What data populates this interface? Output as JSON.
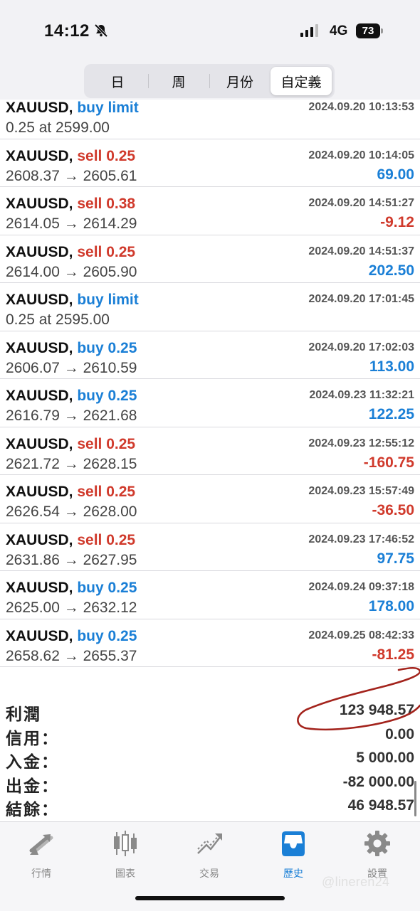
{
  "status_bar": {
    "time": "14:12",
    "network": "4G",
    "battery": "73"
  },
  "segmented": {
    "options": [
      "日",
      "周",
      "月份",
      "自定義"
    ],
    "active_index": 3
  },
  "trades": [
    {
      "symbol": "XAUUSD,",
      "side": "buy",
      "side_label": "buy limit",
      "time": "2024.09.20 10:13:53",
      "price": "0.25 at 2599.00",
      "profit": ""
    },
    {
      "symbol": "XAUUSD,",
      "side": "sell",
      "side_label": "sell 0.25",
      "time": "2024.09.20 10:14:05",
      "price": "2608.37 → 2605.61",
      "profit": "69.00"
    },
    {
      "symbol": "XAUUSD,",
      "side": "sell",
      "side_label": "sell 0.38",
      "time": "2024.09.20 14:51:27",
      "price": "2614.05 → 2614.29",
      "profit": "-9.12"
    },
    {
      "symbol": "XAUUSD,",
      "side": "sell",
      "side_label": "sell 0.25",
      "time": "2024.09.20 14:51:37",
      "price": "2614.00 → 2605.90",
      "profit": "202.50"
    },
    {
      "symbol": "XAUUSD,",
      "side": "buy",
      "side_label": "buy limit",
      "time": "2024.09.20 17:01:45",
      "price": "0.25 at 2595.00",
      "profit": ""
    },
    {
      "symbol": "XAUUSD,",
      "side": "buy",
      "side_label": "buy 0.25",
      "time": "2024.09.20 17:02:03",
      "price": "2606.07 → 2610.59",
      "profit": "113.00"
    },
    {
      "symbol": "XAUUSD,",
      "side": "buy",
      "side_label": "buy 0.25",
      "time": "2024.09.23 11:32:21",
      "price": "2616.79 → 2621.68",
      "profit": "122.25"
    },
    {
      "symbol": "XAUUSD,",
      "side": "sell",
      "side_label": "sell 0.25",
      "time": "2024.09.23 12:55:12",
      "price": "2621.72 → 2628.15",
      "profit": "-160.75"
    },
    {
      "symbol": "XAUUSD,",
      "side": "sell",
      "side_label": "sell 0.25",
      "time": "2024.09.23 15:57:49",
      "price": "2626.54 → 2628.00",
      "profit": "-36.50"
    },
    {
      "symbol": "XAUUSD,",
      "side": "sell",
      "side_label": "sell 0.25",
      "time": "2024.09.23 17:46:52",
      "price": "2631.86 → 2627.95",
      "profit": "97.75"
    },
    {
      "symbol": "XAUUSD,",
      "side": "buy",
      "side_label": "buy 0.25",
      "time": "2024.09.24 09:37:18",
      "price": "2625.00 → 2632.12",
      "profit": "178.00"
    },
    {
      "symbol": "XAUUSD,",
      "side": "buy",
      "side_label": "buy 0.25",
      "time": "2024.09.25 08:42:33",
      "price": "2658.62 → 2655.37",
      "profit": "-81.25"
    }
  ],
  "summary": [
    {
      "label": "利潤",
      "value": "123 948.57"
    },
    {
      "label": "信用：",
      "value": "0.00"
    },
    {
      "label": "入金：",
      "value": "5 000.00"
    },
    {
      "label": "出金：",
      "value": "-82 000.00"
    },
    {
      "label": "結餘：",
      "value": "46 948.57"
    }
  ],
  "tabs": [
    {
      "label": "行情",
      "icon": "quotes-icon",
      "active": false
    },
    {
      "label": "圖表",
      "icon": "chart-icon",
      "active": false
    },
    {
      "label": "交易",
      "icon": "trade-icon",
      "active": false
    },
    {
      "label": "歷史",
      "icon": "history-icon",
      "active": true
    },
    {
      "label": "設置",
      "icon": "settings-icon",
      "active": false
    }
  ],
  "watermark": "@lineren24",
  "colors": {
    "buy": "#1a7fd6",
    "sell": "#d03a2c",
    "active_tab": "#1a7fd6",
    "annotation": "#a3231c"
  }
}
